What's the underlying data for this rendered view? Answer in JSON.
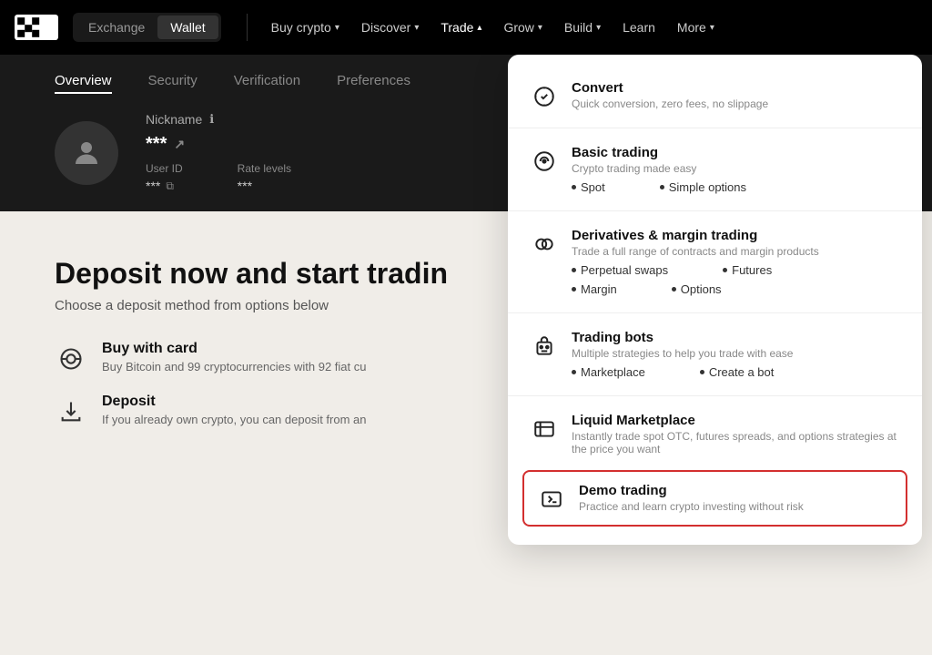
{
  "nav": {
    "exchange_label": "Exchange",
    "wallet_label": "Wallet",
    "buy_crypto": "Buy crypto",
    "discover": "Discover",
    "trade": "Trade",
    "grow": "Grow",
    "build": "Build",
    "learn": "Learn",
    "more": "More"
  },
  "profile": {
    "tabs": [
      "Overview",
      "Security",
      "Verification",
      "Preferences"
    ],
    "active_tab": "Overview",
    "nickname_label": "Nickname",
    "nickname_value": "***",
    "user_id_label": "User ID",
    "user_id_value": "***",
    "rate_levels_label": "Rate levels",
    "rate_levels_value": "***"
  },
  "main": {
    "heading": "Deposit now and start tradin",
    "subheading": "Choose a deposit method from options below",
    "options": [
      {
        "title": "Buy with card",
        "desc": "Buy Bitcoin and 99 cryptocurrencies with 92 fiat cu"
      },
      {
        "title": "Deposit",
        "desc": "If you already own crypto, you can deposit from an"
      }
    ]
  },
  "dropdown": {
    "items": [
      {
        "id": "convert",
        "title": "Convert",
        "desc": "Quick conversion, zero fees, no slippage",
        "sub_items": []
      },
      {
        "id": "basic-trading",
        "title": "Basic trading",
        "desc": "Crypto trading made easy",
        "sub_items": [
          "Spot",
          "Simple options"
        ]
      },
      {
        "id": "derivatives",
        "title": "Derivatives & margin trading",
        "desc": "Trade a full range of contracts and margin products",
        "sub_items": [
          "Perpetual swaps",
          "Futures",
          "Margin",
          "Options"
        ]
      },
      {
        "id": "trading-bots",
        "title": "Trading bots",
        "desc": "Multiple strategies to help you trade with ease",
        "sub_items": [
          "Marketplace",
          "Create a bot"
        ]
      },
      {
        "id": "liquid",
        "title": "Liquid Marketplace",
        "desc": "Instantly trade spot OTC, futures spreads, and options strategies at the price you want",
        "sub_items": []
      },
      {
        "id": "demo",
        "title": "Demo trading",
        "desc": "Practice and learn crypto investing without risk",
        "sub_items": []
      }
    ]
  }
}
